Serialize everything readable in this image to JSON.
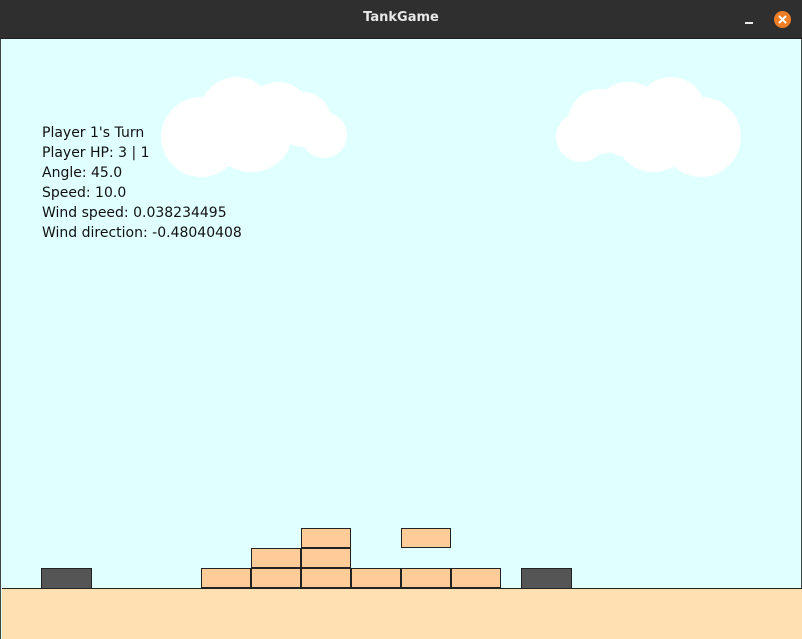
{
  "window": {
    "title": "TankGame"
  },
  "hud": {
    "turn": "Player 1's Turn",
    "hp": "Player HP: 3 | 1",
    "angle": "Angle: 45.0",
    "speed": "Speed: 10.0",
    "wind_speed": "Wind speed: 0.038234495",
    "wind_direction": "Wind direction: -0.48040408"
  },
  "colors": {
    "sky": "#e0ffff",
    "ground": "#ffe0b2",
    "block": "#ffcc99",
    "tank": "#555555",
    "close_button": "#ef7d24"
  },
  "icons": {
    "minimize": "minimize-icon",
    "close": "close-icon"
  }
}
